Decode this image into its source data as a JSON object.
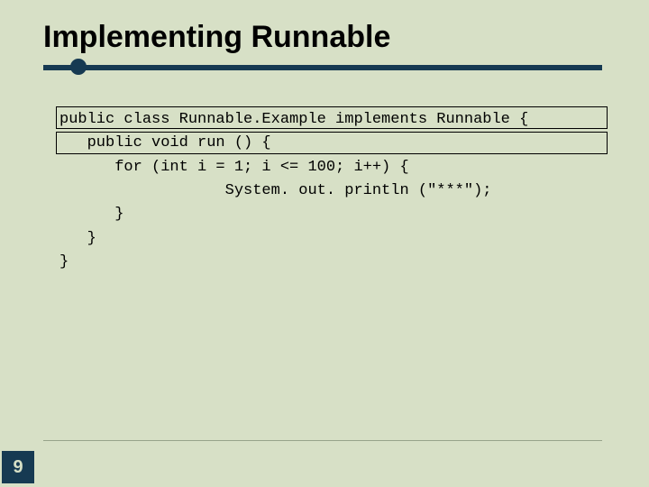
{
  "slide": {
    "title": "Implementing Runnable",
    "page_number": "9"
  },
  "code": {
    "line1": "public class Runnable.Example implements Runnable {",
    "line2": "   public void run () {",
    "line3": "      for (int i = 1; i <= 100; i++) {",
    "line4": "                  System. out. println (\"***\");",
    "line5": "      }",
    "line6": "   }",
    "line7": "}"
  }
}
